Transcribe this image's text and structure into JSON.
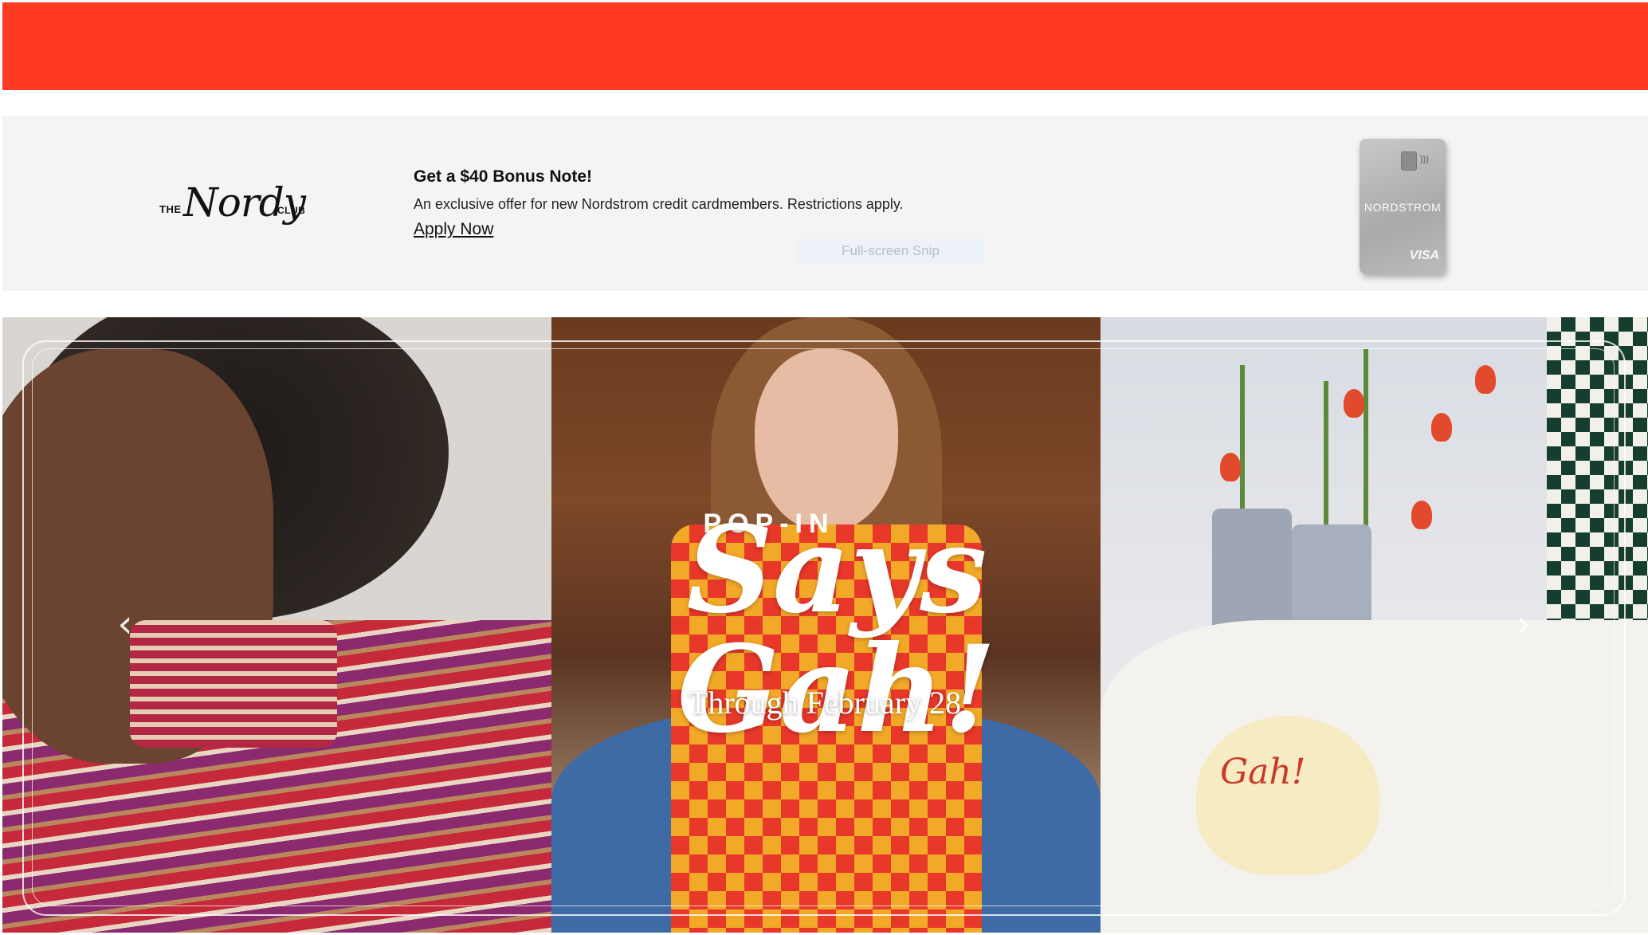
{
  "colors": {
    "top_banner": "#ff3a22",
    "promo_background": "#f4f4f4"
  },
  "promo": {
    "logo_prefix": "THE",
    "logo_script": "Nordy",
    "logo_suffix": "CLUB",
    "title": "Get a $40 Bonus Note!",
    "description": "An exclusive offer for new Nordstrom credit cardmembers. Restrictions apply.",
    "link_label": "Apply Now",
    "card_brand": "NORDSTROM",
    "card_network": "VISA"
  },
  "overlay": {
    "snip_label": "Full-screen Snip"
  },
  "hero": {
    "kicker": "POP-IN",
    "headline": "Says Gah!",
    "subline": "Through February 28",
    "cap_text": "Gah!",
    "prev_arrow": "‹",
    "next_arrow": "›"
  }
}
